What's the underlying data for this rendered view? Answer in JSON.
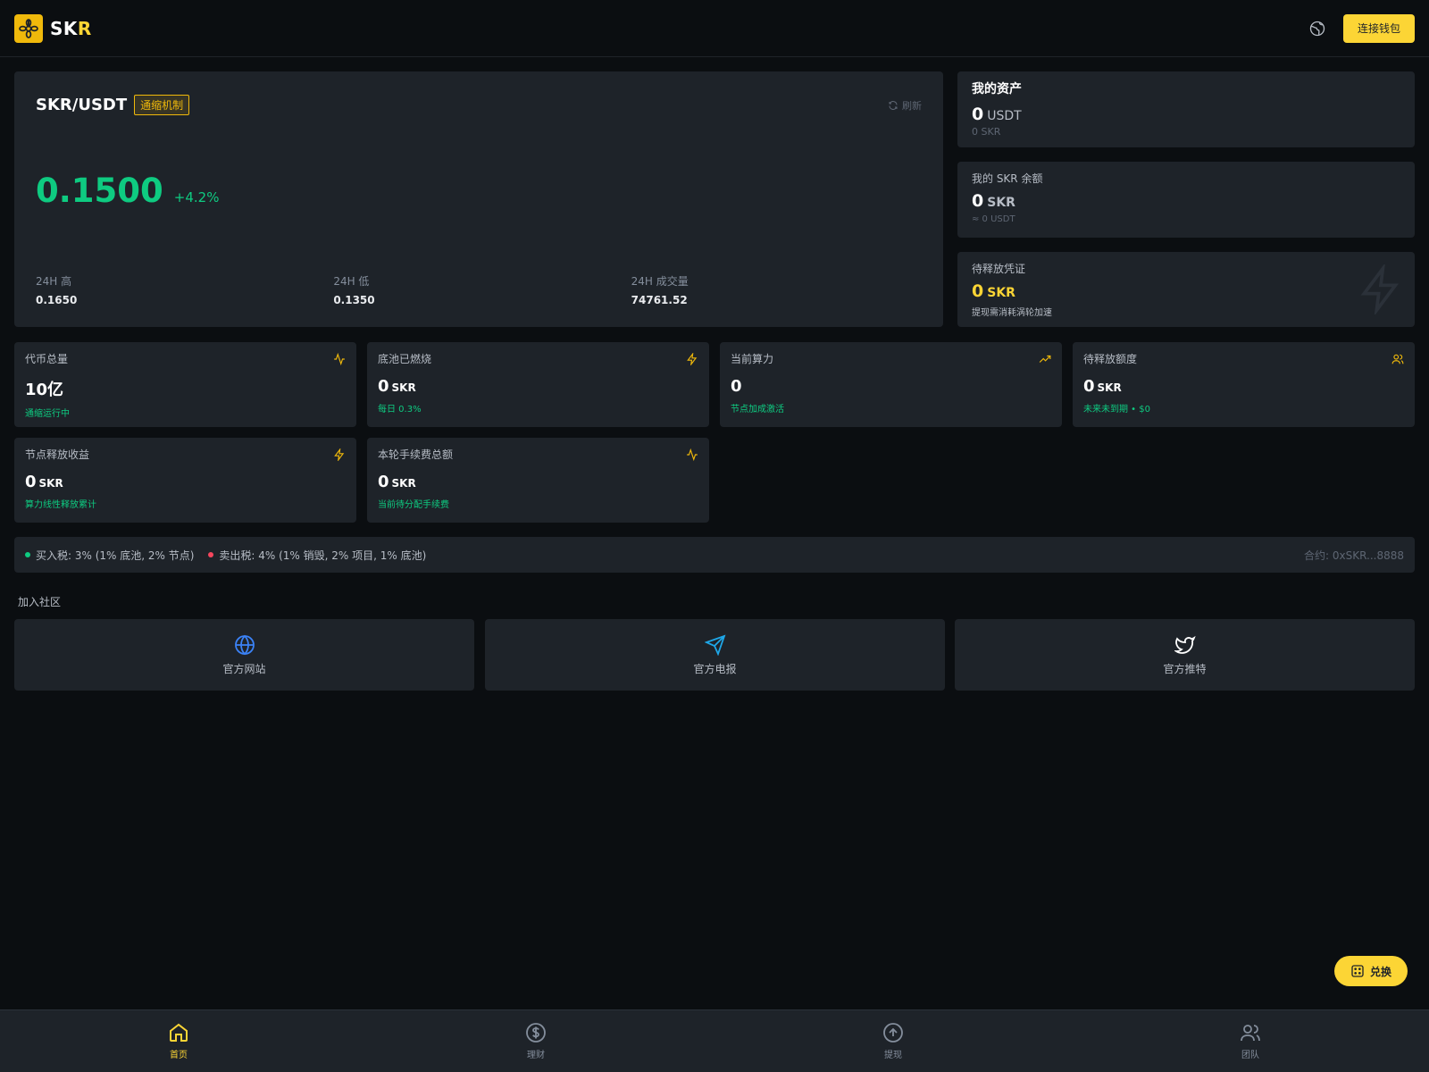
{
  "header": {
    "brand_main": "SK",
    "brand_accent": "R",
    "connect_label": "连接钱包"
  },
  "market": {
    "pair": "SKR/USDT",
    "tag": "通缩机制",
    "refresh_label": "刷新",
    "price": "0.1500",
    "change": "+4.2%",
    "stats": [
      {
        "label": "24H 高",
        "value": "0.1650"
      },
      {
        "label": "24H 低",
        "value": "0.1350"
      },
      {
        "label": "24H 成交量",
        "value": "74761.52"
      }
    ]
  },
  "assets": {
    "title": "我的资产",
    "value": "0",
    "unit": "USDT",
    "sub": "0 SKR"
  },
  "balance": {
    "title": "我的 SKR 余额",
    "value": "0",
    "unit": "SKR",
    "sub": "≈ 0 USDT"
  },
  "pending": {
    "title": "待释放凭证",
    "value": "0",
    "unit": "SKR",
    "sub": "提现需消耗涡轮加速"
  },
  "cards": [
    {
      "title": "代币总量",
      "value": "10亿",
      "unit": "",
      "sub": "通缩运行中",
      "icon": "activity-icon"
    },
    {
      "title": "底池已燃烧",
      "value": "0",
      "unit": "SKR",
      "sub": "每日 0.3%",
      "icon": "zap-icon"
    },
    {
      "title": "当前算力",
      "value": "0",
      "unit": "",
      "sub": "节点加成激活",
      "icon": "trending-up-icon"
    },
    {
      "title": "待释放额度",
      "value": "0",
      "unit": "SKR",
      "sub": "未来未到期 • $0",
      "icon": "users-icon"
    },
    {
      "title": "节点释放收益",
      "value": "0",
      "unit": "SKR",
      "sub": "算力线性释放累计",
      "icon": "zap-icon"
    },
    {
      "title": "本轮手续费总额",
      "value": "0",
      "unit": "SKR",
      "sub": "当前待分配手续费",
      "icon": "activity-icon"
    }
  ],
  "tax": {
    "buy": "买入税: 3% (1% 底池, 2% 节点)",
    "sell": "卖出税: 4% (1% 销毁, 2% 项目, 1% 底池)",
    "contract": "合约: 0xSKR...8888",
    "buy_color": "#0ecb81",
    "sell_color": "#f6465d"
  },
  "community": {
    "title": "加入社区",
    "links": [
      {
        "label": "官方网站",
        "icon": "globe-icon",
        "color": "#3b82f6"
      },
      {
        "label": "官方电报",
        "icon": "send-icon",
        "color": "#1ea7e8"
      },
      {
        "label": "官方推特",
        "icon": "twitter-icon",
        "color": "#ffffff"
      }
    ]
  },
  "exchange_label": "兑换",
  "nav": [
    {
      "label": "首页",
      "icon": "home-icon",
      "active": true
    },
    {
      "label": "理财",
      "icon": "dollar-circle-icon",
      "active": false
    },
    {
      "label": "提现",
      "icon": "arrow-up-circle-icon",
      "active": false
    },
    {
      "label": "团队",
      "icon": "users-icon",
      "active": false
    }
  ],
  "colors": {
    "accent": "#fcd535",
    "up": "#0ecb81",
    "down": "#f6465d",
    "bg": "#0b0e11",
    "panel": "#1e2329"
  }
}
